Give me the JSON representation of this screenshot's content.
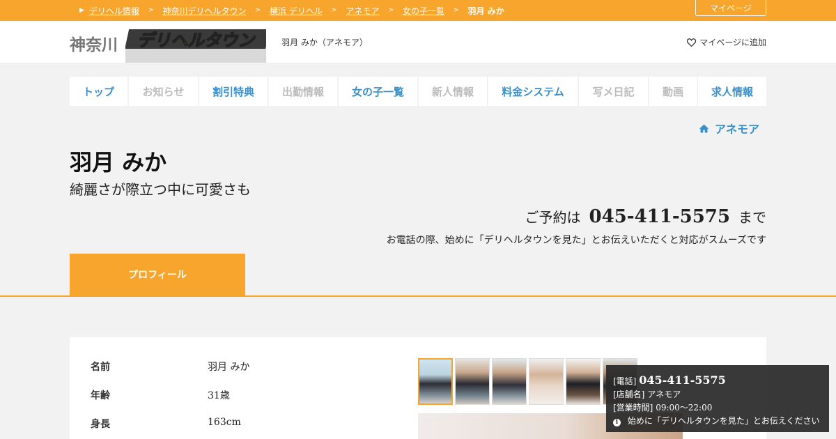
{
  "breadcrumb": {
    "items": [
      "デリヘル情報",
      "神奈川デリヘルタウン",
      "横浜 デリヘル",
      "アネモア",
      "女の子一覧"
    ],
    "current": "羽月 みか",
    "separator": ">"
  },
  "topbar": {
    "mypage": "マイページ"
  },
  "header": {
    "region": "神奈川",
    "logo_text": "デリヘルタウン",
    "page_subtitle": "羽月 みか（アネモア）",
    "add_mypage": "マイページに追加"
  },
  "nav": {
    "items": [
      {
        "label": "トップ",
        "active": true
      },
      {
        "label": "お知らせ",
        "active": false
      },
      {
        "label": "割引特典",
        "active": true
      },
      {
        "label": "出勤情報",
        "active": false
      },
      {
        "label": "女の子一覧",
        "active": true
      },
      {
        "label": "新人情報",
        "active": false
      },
      {
        "label": "料金システム",
        "active": true
      },
      {
        "label": "写メ日記",
        "active": false
      },
      {
        "label": "動画",
        "active": false
      },
      {
        "label": "求人情報",
        "active": true
      }
    ]
  },
  "shop": {
    "name": "アネモア"
  },
  "girl": {
    "name": "羽月 みか",
    "catchphrase": "綺麗さが際立つ中に可愛さも"
  },
  "reserve": {
    "prefix": "ご予約は",
    "tel": "045-411-5575",
    "suffix": "まで",
    "note": "お電話の際、始めに「デリヘルタウンを見た」とお伝えいただくと対応がスムーズです"
  },
  "tabs": {
    "profile": "プロフィール"
  },
  "profile": {
    "rows": [
      {
        "label": "名前",
        "value": "羽月 みか"
      },
      {
        "label": "年齢",
        "value": "31歳"
      },
      {
        "label": "身長",
        "value": "163cm"
      }
    ]
  },
  "tooltip": {
    "tel_label": "[電話]",
    "tel": "045-411-5575",
    "shop_label": "[店舗名]",
    "shop": "アネモア",
    "hours_label": "[営業時間]",
    "hours": "09:00～22:00",
    "notice": "始めに「デリヘルタウンを見た」とお伝えください"
  },
  "colors": {
    "accent": "#f7a52c",
    "link": "#3a8fc8",
    "inactive": "#bbbbbb"
  }
}
